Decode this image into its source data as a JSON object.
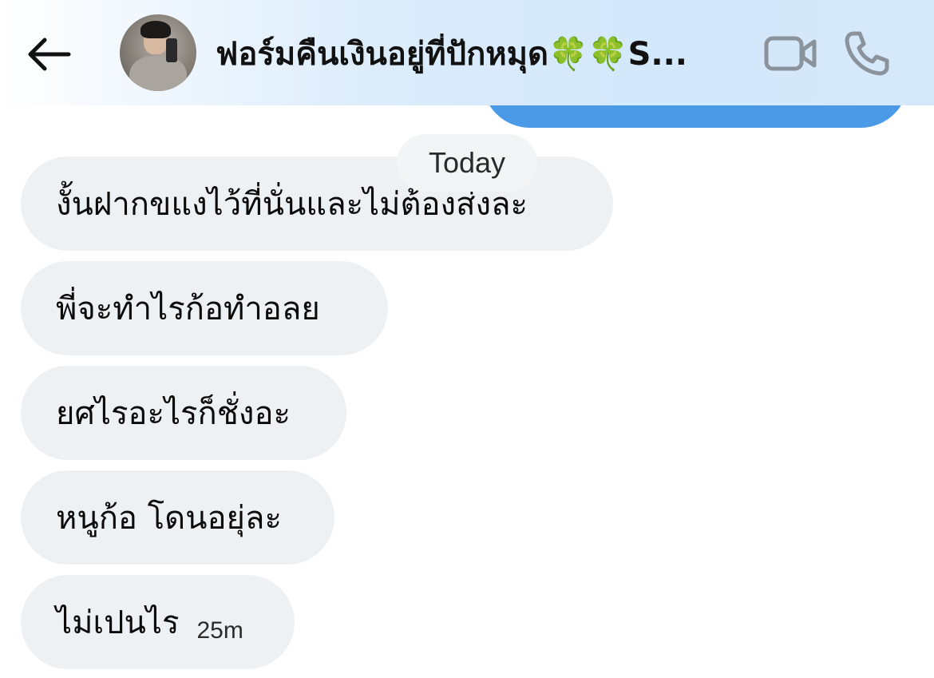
{
  "header": {
    "back_icon": "arrow-left-icon",
    "title": "ฟอร์มคืนเงินอยู่ที่ปักหมุด🍀🍀S...",
    "video_icon": "video-camera-icon",
    "call_icon": "phone-icon",
    "icon_color": "#8a929c"
  },
  "colors": {
    "sent_bubble": "#4a9ae8",
    "received_bubble": "#eef1f4",
    "date_pill": "#f3f4f6",
    "header_tint": "#d3e8fb"
  },
  "date_separator": "Today",
  "messages": [
    {
      "direction": "received",
      "text": "งั้นฝากขแงไว้ที่นั่นและไม่ต้องส่งละ"
    },
    {
      "direction": "received",
      "text": "พี่จะทำไรก้อทำอลย"
    },
    {
      "direction": "received",
      "text": "ยศไรอะไรก็ชั่งอะ"
    },
    {
      "direction": "received",
      "text": "หนูก้อ โดนอยุ่ละ"
    },
    {
      "direction": "received",
      "text": "ไม่เปนไร",
      "time": "25m"
    }
  ]
}
